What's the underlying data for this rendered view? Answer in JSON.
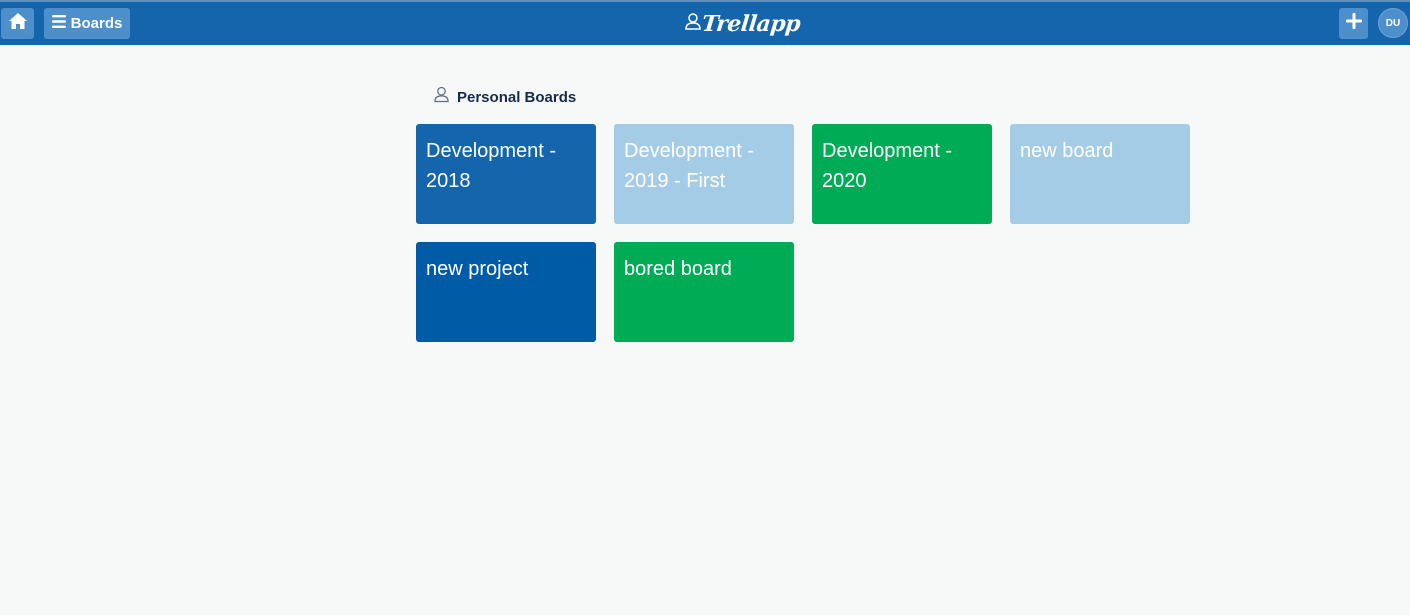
{
  "header": {
    "boards_label": "Boards",
    "logo_text": "Trellapp",
    "avatar_initials": "DU"
  },
  "section": {
    "title": "Personal Boards"
  },
  "boards": [
    {
      "title": "Development - 2018",
      "color": "#1565ad"
    },
    {
      "title": "Development - 2019 - First",
      "color": "#a5cce6"
    },
    {
      "title": "Development - 2020",
      "color": "#00ab55"
    },
    {
      "title": "new board",
      "color": "#a5cce6"
    },
    {
      "title": "new project",
      "color": "#005ba6"
    },
    {
      "title": "bored board",
      "color": "#00ab55"
    }
  ],
  "colors": {
    "header_bg": "#1565ad",
    "button_bg": "#4d8fcb",
    "page_bg": "#f7f9f9"
  },
  "icons": [
    "home-icon",
    "menu-icon",
    "user-icon",
    "plus-icon"
  ]
}
